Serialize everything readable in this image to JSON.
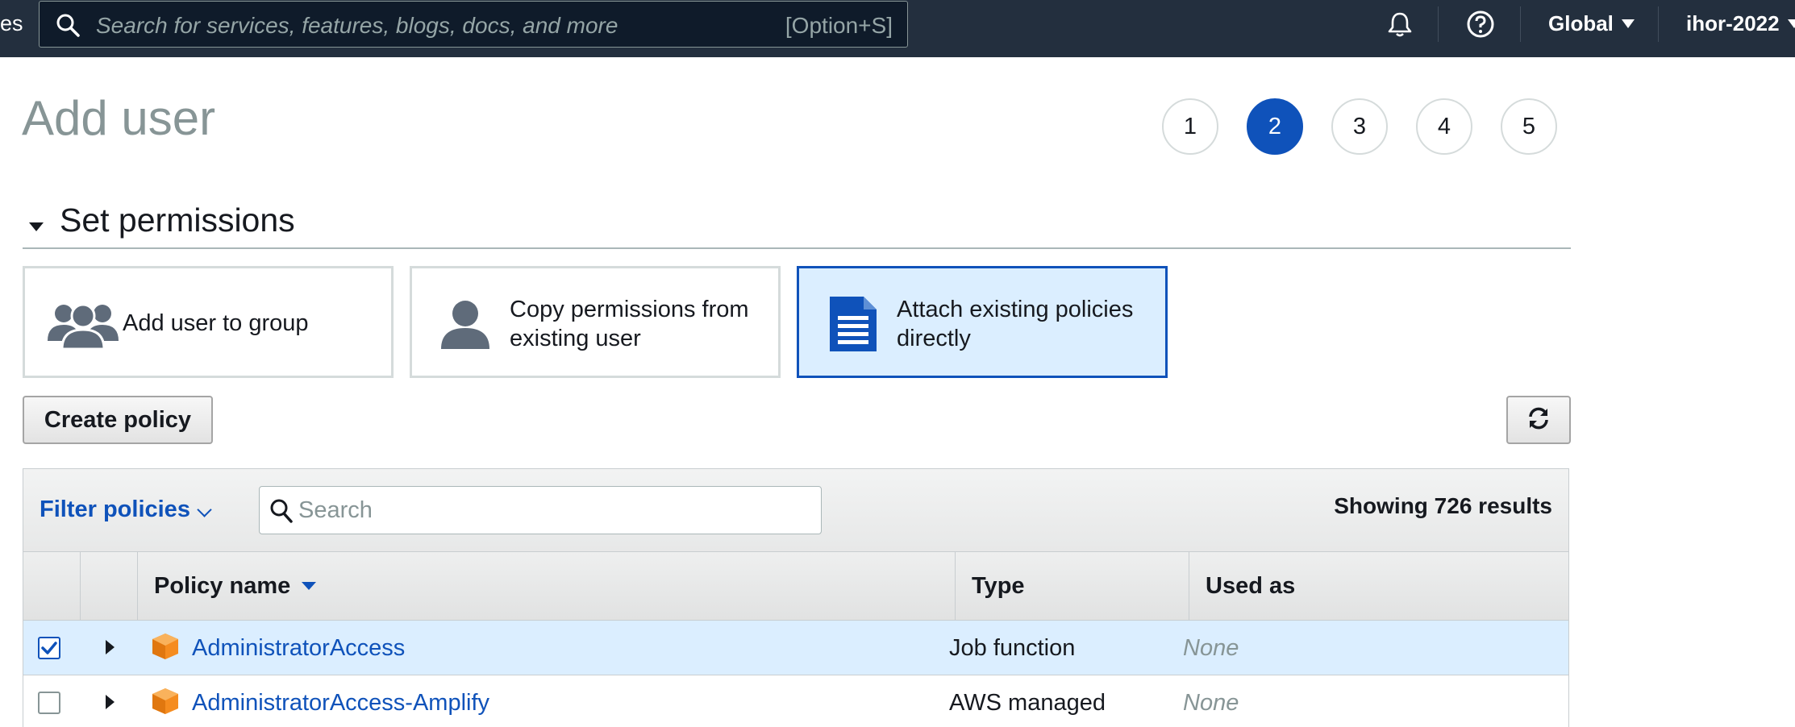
{
  "topbar": {
    "edge_text": "es",
    "search_placeholder": "Search for services, features, blogs, docs, and more",
    "search_shortcut": "[Option+S]",
    "region": "Global",
    "account": "ihor-2022"
  },
  "page": {
    "title": "Add user",
    "steps": [
      "1",
      "2",
      "3",
      "4",
      "5"
    ],
    "active_step": "2"
  },
  "section": {
    "title": "Set permissions"
  },
  "options": [
    {
      "label": "Add user to group",
      "icon": "users-group-icon",
      "selected": false
    },
    {
      "label_line1": "Copy permissions from",
      "label_line2": "existing user",
      "icon": "user-icon",
      "selected": false
    },
    {
      "label_line1": "Attach existing policies",
      "label_line2": "directly",
      "icon": "document-icon",
      "selected": true
    }
  ],
  "actions": {
    "create_policy": "Create policy",
    "refresh_icon": "refresh-icon"
  },
  "table": {
    "filter_label": "Filter policies",
    "search_placeholder": "Search",
    "results_text": "Showing 726 results",
    "columns": {
      "name": "Policy name",
      "type": "Type",
      "used_as": "Used as"
    },
    "rows": [
      {
        "checked": true,
        "name": "AdministratorAccess",
        "type": "Job function",
        "used_as": "None"
      },
      {
        "checked": false,
        "name": "AdministratorAccess-Amplify",
        "type": "AWS managed",
        "used_as": "None"
      }
    ]
  },
  "colors": {
    "nav_bg": "#232f3e",
    "accent": "#0f52ba",
    "selected_bg": "#dbeeff",
    "policy_icon": "#f58c1f"
  }
}
